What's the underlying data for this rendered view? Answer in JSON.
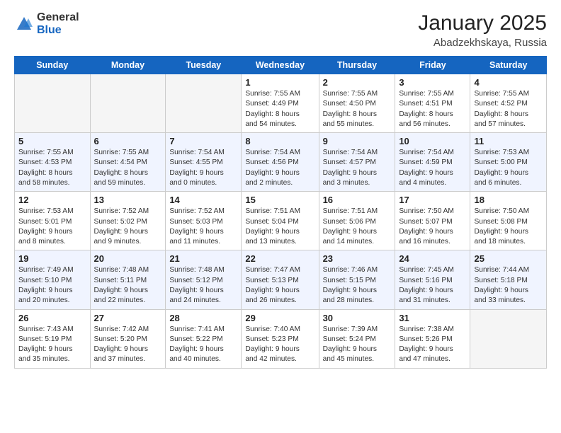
{
  "logo": {
    "general": "General",
    "blue": "Blue"
  },
  "header": {
    "title": "January 2025",
    "subtitle": "Abadzekhskaya, Russia"
  },
  "weekdays": [
    "Sunday",
    "Monday",
    "Tuesday",
    "Wednesday",
    "Thursday",
    "Friday",
    "Saturday"
  ],
  "weeks": [
    [
      {
        "day": "",
        "info": ""
      },
      {
        "day": "",
        "info": ""
      },
      {
        "day": "",
        "info": ""
      },
      {
        "day": "1",
        "info": "Sunrise: 7:55 AM\nSunset: 4:49 PM\nDaylight: 8 hours\nand 54 minutes."
      },
      {
        "day": "2",
        "info": "Sunrise: 7:55 AM\nSunset: 4:50 PM\nDaylight: 8 hours\nand 55 minutes."
      },
      {
        "day": "3",
        "info": "Sunrise: 7:55 AM\nSunset: 4:51 PM\nDaylight: 8 hours\nand 56 minutes."
      },
      {
        "day": "4",
        "info": "Sunrise: 7:55 AM\nSunset: 4:52 PM\nDaylight: 8 hours\nand 57 minutes."
      }
    ],
    [
      {
        "day": "5",
        "info": "Sunrise: 7:55 AM\nSunset: 4:53 PM\nDaylight: 8 hours\nand 58 minutes."
      },
      {
        "day": "6",
        "info": "Sunrise: 7:55 AM\nSunset: 4:54 PM\nDaylight: 8 hours\nand 59 minutes."
      },
      {
        "day": "7",
        "info": "Sunrise: 7:54 AM\nSunset: 4:55 PM\nDaylight: 9 hours\nand 0 minutes."
      },
      {
        "day": "8",
        "info": "Sunrise: 7:54 AM\nSunset: 4:56 PM\nDaylight: 9 hours\nand 2 minutes."
      },
      {
        "day": "9",
        "info": "Sunrise: 7:54 AM\nSunset: 4:57 PM\nDaylight: 9 hours\nand 3 minutes."
      },
      {
        "day": "10",
        "info": "Sunrise: 7:54 AM\nSunset: 4:59 PM\nDaylight: 9 hours\nand 4 minutes."
      },
      {
        "day": "11",
        "info": "Sunrise: 7:53 AM\nSunset: 5:00 PM\nDaylight: 9 hours\nand 6 minutes."
      }
    ],
    [
      {
        "day": "12",
        "info": "Sunrise: 7:53 AM\nSunset: 5:01 PM\nDaylight: 9 hours\nand 8 minutes."
      },
      {
        "day": "13",
        "info": "Sunrise: 7:52 AM\nSunset: 5:02 PM\nDaylight: 9 hours\nand 9 minutes."
      },
      {
        "day": "14",
        "info": "Sunrise: 7:52 AM\nSunset: 5:03 PM\nDaylight: 9 hours\nand 11 minutes."
      },
      {
        "day": "15",
        "info": "Sunrise: 7:51 AM\nSunset: 5:04 PM\nDaylight: 9 hours\nand 13 minutes."
      },
      {
        "day": "16",
        "info": "Sunrise: 7:51 AM\nSunset: 5:06 PM\nDaylight: 9 hours\nand 14 minutes."
      },
      {
        "day": "17",
        "info": "Sunrise: 7:50 AM\nSunset: 5:07 PM\nDaylight: 9 hours\nand 16 minutes."
      },
      {
        "day": "18",
        "info": "Sunrise: 7:50 AM\nSunset: 5:08 PM\nDaylight: 9 hours\nand 18 minutes."
      }
    ],
    [
      {
        "day": "19",
        "info": "Sunrise: 7:49 AM\nSunset: 5:10 PM\nDaylight: 9 hours\nand 20 minutes."
      },
      {
        "day": "20",
        "info": "Sunrise: 7:48 AM\nSunset: 5:11 PM\nDaylight: 9 hours\nand 22 minutes."
      },
      {
        "day": "21",
        "info": "Sunrise: 7:48 AM\nSunset: 5:12 PM\nDaylight: 9 hours\nand 24 minutes."
      },
      {
        "day": "22",
        "info": "Sunrise: 7:47 AM\nSunset: 5:13 PM\nDaylight: 9 hours\nand 26 minutes."
      },
      {
        "day": "23",
        "info": "Sunrise: 7:46 AM\nSunset: 5:15 PM\nDaylight: 9 hours\nand 28 minutes."
      },
      {
        "day": "24",
        "info": "Sunrise: 7:45 AM\nSunset: 5:16 PM\nDaylight: 9 hours\nand 31 minutes."
      },
      {
        "day": "25",
        "info": "Sunrise: 7:44 AM\nSunset: 5:18 PM\nDaylight: 9 hours\nand 33 minutes."
      }
    ],
    [
      {
        "day": "26",
        "info": "Sunrise: 7:43 AM\nSunset: 5:19 PM\nDaylight: 9 hours\nand 35 minutes."
      },
      {
        "day": "27",
        "info": "Sunrise: 7:42 AM\nSunset: 5:20 PM\nDaylight: 9 hours\nand 37 minutes."
      },
      {
        "day": "28",
        "info": "Sunrise: 7:41 AM\nSunset: 5:22 PM\nDaylight: 9 hours\nand 40 minutes."
      },
      {
        "day": "29",
        "info": "Sunrise: 7:40 AM\nSunset: 5:23 PM\nDaylight: 9 hours\nand 42 minutes."
      },
      {
        "day": "30",
        "info": "Sunrise: 7:39 AM\nSunset: 5:24 PM\nDaylight: 9 hours\nand 45 minutes."
      },
      {
        "day": "31",
        "info": "Sunrise: 7:38 AM\nSunset: 5:26 PM\nDaylight: 9 hours\nand 47 minutes."
      },
      {
        "day": "",
        "info": ""
      }
    ]
  ]
}
